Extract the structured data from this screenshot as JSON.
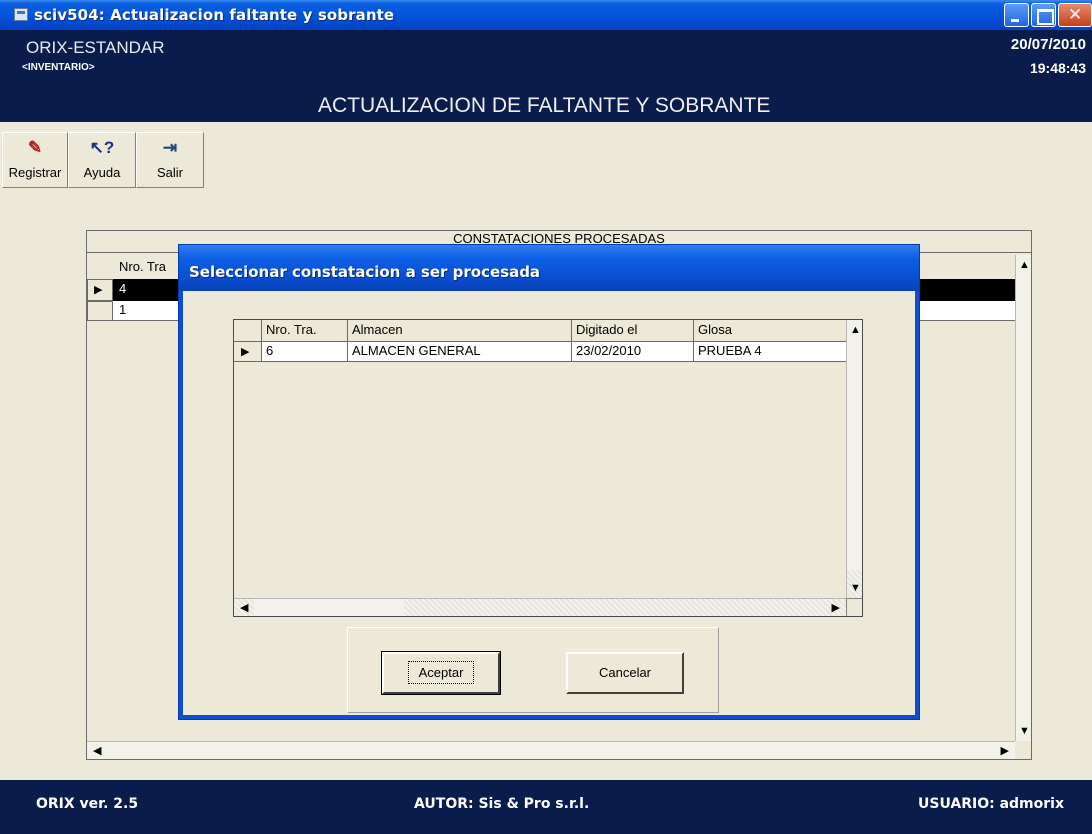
{
  "window": {
    "title": "sciv504: Actualizacion faltante y sobrante"
  },
  "header": {
    "system_name": "ORIX-ESTANDAR",
    "module": "<INVENTARIO>",
    "screen_title": "ACTUALIZACION DE FALTANTE Y SOBRANTE",
    "date": "20/07/2010",
    "time": "19:48:43"
  },
  "toolbar": {
    "items": [
      {
        "label": "Registrar",
        "icon": "register-icon"
      },
      {
        "label": "Ayuda",
        "icon": "help-icon"
      },
      {
        "label": "Salir",
        "icon": "exit-icon"
      }
    ]
  },
  "background_grid": {
    "caption": "CONSTATACIONES PROCESADAS",
    "column_header": "Nro. Tra",
    "rows": [
      "4",
      "1"
    ]
  },
  "dialog": {
    "title": "Seleccionar constatacion a ser procesada",
    "grid": {
      "columns": [
        "Nro. Tra.",
        "Almacen",
        "Digitado el",
        "Glosa"
      ],
      "rows": [
        [
          "6",
          "ALMACEN GENERAL",
          "23/02/2010",
          "PRUEBA 4"
        ]
      ]
    },
    "accept_label": "Aceptar",
    "cancel_label": "Cancelar"
  },
  "statusbar": {
    "version": "ORIX ver. 2.5",
    "author": "AUTOR: Sis & Pro s.r.l.",
    "user": "USUARIO: admorix"
  },
  "colors": {
    "title_bar": "#0453d9",
    "header_bg": "#0a1c4c",
    "window_bg": "#ece9d8",
    "selected_row": "#000000"
  }
}
